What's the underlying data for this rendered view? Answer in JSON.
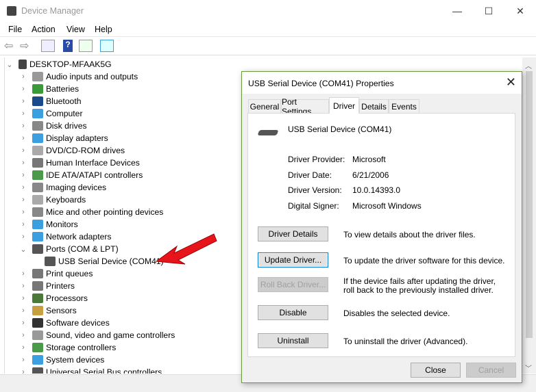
{
  "window": {
    "title": "Device Manager",
    "minimize": "—",
    "maximize": "☐",
    "close": "✕"
  },
  "menu": [
    "File",
    "Action",
    "View",
    "Help"
  ],
  "toolbar": [
    "back-icon",
    "forward-icon",
    "show-hide-console-tree-icon",
    "help-icon",
    "action-pane-icon",
    "scan-hardware-icon"
  ],
  "tree": {
    "root": "DESKTOP-MFAAK5G",
    "items": [
      {
        "label": "Audio inputs and outputs",
        "color": "#999"
      },
      {
        "label": "Batteries",
        "color": "#3a9a3a"
      },
      {
        "label": "Bluetooth",
        "color": "#1a4a8a"
      },
      {
        "label": "Computer",
        "color": "#3ca0e0"
      },
      {
        "label": "Disk drives",
        "color": "#888"
      },
      {
        "label": "Display adapters",
        "color": "#3ca0e0"
      },
      {
        "label": "DVD/CD-ROM drives",
        "color": "#aaa"
      },
      {
        "label": "Human Interface Devices",
        "color": "#777"
      },
      {
        "label": "IDE ATA/ATAPI controllers",
        "color": "#4a9a4a"
      },
      {
        "label": "Imaging devices",
        "color": "#888"
      },
      {
        "label": "Keyboards",
        "color": "#aaa"
      },
      {
        "label": "Mice and other pointing devices",
        "color": "#888"
      },
      {
        "label": "Monitors",
        "color": "#3ca0e0"
      },
      {
        "label": "Network adapters",
        "color": "#3ca0e0"
      },
      {
        "label": "Ports (COM & LPT)",
        "color": "#555",
        "expanded": true
      },
      {
        "label": "USB Serial Device (COM41)",
        "color": "#555",
        "child": true
      },
      {
        "label": "Print queues",
        "color": "#777"
      },
      {
        "label": "Printers",
        "color": "#777"
      },
      {
        "label": "Processors",
        "color": "#4a7a3a"
      },
      {
        "label": "Sensors",
        "color": "#c8a040"
      },
      {
        "label": "Software devices",
        "color": "#333"
      },
      {
        "label": "Sound, video and game controllers",
        "color": "#999"
      },
      {
        "label": "Storage controllers",
        "color": "#4a9a4a"
      },
      {
        "label": "System devices",
        "color": "#3ca0e0"
      },
      {
        "label": "Universal Serial Bus controllers",
        "color": "#555"
      }
    ]
  },
  "dialog": {
    "title": "USB Serial Device (COM41) Properties",
    "close": "✕",
    "tabs": [
      "General",
      "Port Settings",
      "Driver",
      "Details",
      "Events"
    ],
    "active_tab": "Driver",
    "device_name": "USB Serial Device (COM41)",
    "fields": [
      {
        "label": "Driver Provider:",
        "value": "Microsoft"
      },
      {
        "label": "Driver Date:",
        "value": "6/21/2006"
      },
      {
        "label": "Driver Version:",
        "value": "10.0.14393.0"
      },
      {
        "label": "Digital Signer:",
        "value": "Microsoft Windows"
      }
    ],
    "actions": [
      {
        "label": "Driver Details",
        "desc": "To view details about the driver files.",
        "state": "normal"
      },
      {
        "label": "Update Driver...",
        "desc": "To update the driver software for this device.",
        "state": "focused"
      },
      {
        "label": "Roll Back Driver...",
        "desc": "If the device fails after updating the driver, roll back to the previously installed driver.",
        "state": "disabled"
      },
      {
        "label": "Disable",
        "desc": "Disables the selected device.",
        "state": "normal"
      },
      {
        "label": "Uninstall",
        "desc": "To uninstall the driver (Advanced).",
        "state": "normal"
      }
    ],
    "close_button": "Close",
    "cancel_button": "Cancel"
  },
  "annotation_color": "#e8141c"
}
